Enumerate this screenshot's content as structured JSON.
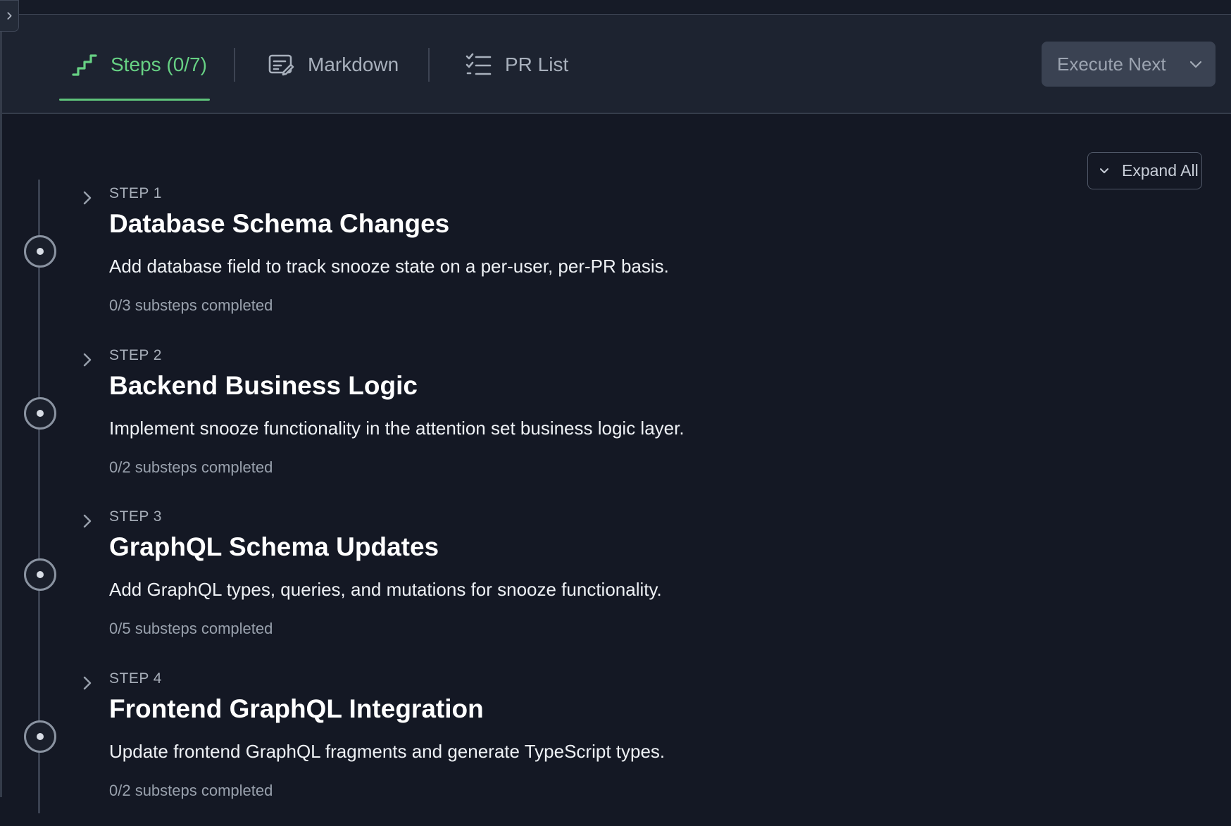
{
  "header": {
    "tabs": [
      {
        "label": "Steps (0/7)",
        "icon": "steps-icon",
        "active": true
      },
      {
        "label": "Markdown",
        "icon": "markdown-edit-icon",
        "active": false
      },
      {
        "label": "PR List",
        "icon": "checklist-icon",
        "active": false
      }
    ],
    "execute_button": {
      "label": "Execute Next",
      "icon": "chevron-down-icon"
    }
  },
  "toolbar": {
    "expand_all_label": "Expand All",
    "expand_icon": "chevron-down-icon"
  },
  "steps": [
    {
      "label": "STEP 1",
      "title": "Database Schema Changes",
      "description": "Add database field to track snooze state on a per-user, per-PR basis.",
      "progress": "0/3 substeps completed"
    },
    {
      "label": "STEP 2",
      "title": "Backend Business Logic",
      "description": "Implement snooze functionality in the attention set business logic layer.",
      "progress": "0/2 substeps completed"
    },
    {
      "label": "STEP 3",
      "title": "GraphQL Schema Updates",
      "description": "Add GraphQL types, queries, and mutations for snooze functionality.",
      "progress": "0/5 substeps completed"
    },
    {
      "label": "STEP 4",
      "title": "Frontend GraphQL Integration",
      "description": "Update frontend GraphQL fragments and generate TypeScript types.",
      "progress": "0/2 substeps completed"
    }
  ],
  "colors": {
    "accent": "#67d184",
    "background": "#141824",
    "header_background": "#1d2330",
    "button_background": "#3a4252"
  }
}
